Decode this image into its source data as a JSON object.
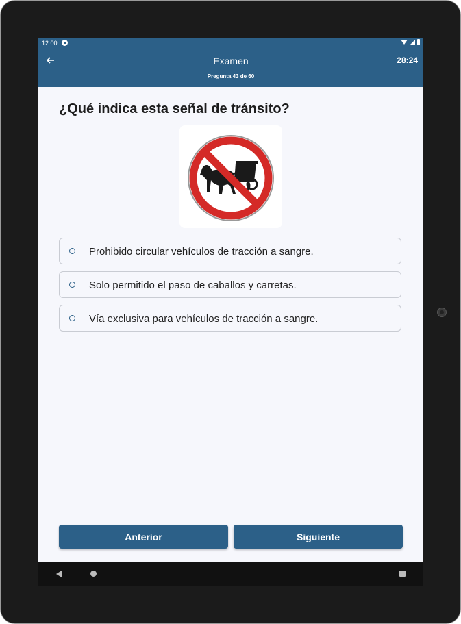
{
  "status_bar": {
    "time": "12:00"
  },
  "app_bar": {
    "title": "Examen",
    "timer": "28:24",
    "subtitle": "Pregunta 43 de 60"
  },
  "question": {
    "text": "¿Qué indica esta señal de tránsito?",
    "image": "prohibited-horse-carriage-sign"
  },
  "options": [
    {
      "label": "Prohibido circular vehículos de tracción a sangre.",
      "selected": false
    },
    {
      "label": "Solo permitido el paso de caballos y carretas.",
      "selected": false
    },
    {
      "label": "Vía exclusiva para vehículos de tracción a sangre.",
      "selected": false
    }
  ],
  "buttons": {
    "previous": "Anterior",
    "next": "Siguiente"
  },
  "colors": {
    "primary": "#2c6088",
    "background": "#f6f7fc",
    "sign_red": "#d42a27"
  }
}
